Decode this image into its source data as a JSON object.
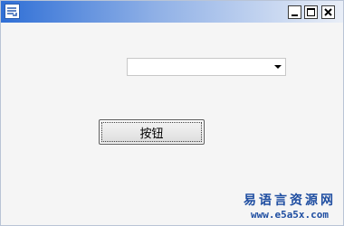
{
  "window": {
    "title": "",
    "icon": "app-icon",
    "controls": [
      "minimize-icon",
      "maximize-icon",
      "close-icon"
    ]
  },
  "combobox": {
    "value": ""
  },
  "button": {
    "label": "按钮"
  },
  "watermark": {
    "title": "易语言资源网",
    "url": "www.e5a5x.com"
  },
  "colors": {
    "titlebar_start": "#2f6fd6",
    "titlebar_end": "#e9eef7",
    "watermark": "#1f4ea1"
  }
}
